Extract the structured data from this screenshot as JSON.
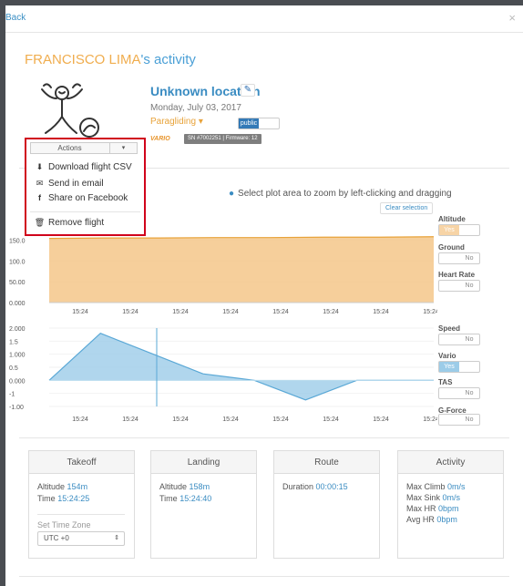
{
  "topbar": {
    "back_label": "Back",
    "close_label": "×"
  },
  "header": {
    "pilot_name": "FRANCISCO LIMA",
    "title_suffix": "'s activity"
  },
  "flight": {
    "location": "Unknown location",
    "date": "Monday, July 03, 2017",
    "sport": "Paragliding",
    "visibility": "public",
    "device_brand": "VARIO",
    "device_info": "SN #7002251 | Firmware: 12"
  },
  "actions": {
    "button_label": "Actions",
    "items": [
      {
        "label": "Download flight CSV",
        "icon": "download-icon"
      },
      {
        "label": "Send in email",
        "icon": "envelope-icon"
      },
      {
        "label": "Share on Facebook",
        "icon": "facebook-icon"
      },
      {
        "label": "Remove flight",
        "icon": "trash-icon"
      }
    ]
  },
  "chart_controls": {
    "select_info": "Select plot area to zoom by left-clicking and dragging",
    "clear_label": "Clear selection"
  },
  "toggles": {
    "altitude": {
      "label": "Altitude",
      "value": "Yes"
    },
    "ground": {
      "label": "Ground",
      "value": "No"
    },
    "heart_rate": {
      "label": "Heart Rate",
      "value": "No"
    },
    "speed": {
      "label": "Speed",
      "value": "No"
    },
    "vario": {
      "label": "Vario",
      "value": "Yes"
    },
    "tas": {
      "label": "TAS",
      "value": "No"
    },
    "gforce": {
      "label": "G-Force",
      "value": "No"
    }
  },
  "chart_data": [
    {
      "type": "area",
      "x_tick_labels": [
        "15:24",
        "15:24",
        "15:24",
        "15:24",
        "15:24",
        "15:24",
        "15:24",
        "15:24"
      ],
      "y_tick_labels": [
        "150.0",
        "100.0",
        "50.00",
        "0.000"
      ],
      "ylim": [
        0,
        175
      ],
      "series": [
        {
          "name": "Altitude",
          "color": "#f5c78a",
          "values": [
            154,
            155,
            155,
            156,
            156,
            157,
            157,
            158
          ]
        }
      ]
    },
    {
      "type": "area",
      "x_tick_labels": [
        "15:24",
        "15:24",
        "15:24",
        "15:24",
        "15:24",
        "15:24",
        "15:24",
        "15:24"
      ],
      "y_tick_labels": [
        "2.000",
        "1.5",
        "1.000",
        "0.5",
        "0.000",
        "-1",
        "-1.00"
      ],
      "ylim": [
        -1,
        2
      ],
      "series": [
        {
          "name": "Vario",
          "color": "#9ccce8",
          "x_seconds": [
            0,
            2,
            6,
            8,
            10,
            12,
            15
          ],
          "values": [
            0,
            1.8,
            0.25,
            0.0,
            -0.75,
            0.0,
            0.0
          ]
        }
      ]
    }
  ],
  "cards": {
    "takeoff": {
      "title": "Takeoff",
      "altitude_label": "Altitude",
      "altitude": "154m",
      "time_label": "Time",
      "time": "15:24:25",
      "tz_label": "Set Time Zone",
      "tz_value": "UTC +0"
    },
    "landing": {
      "title": "Landing",
      "altitude_label": "Altitude",
      "altitude": "158m",
      "time_label": "Time",
      "time": "15:24:40"
    },
    "route": {
      "title": "Route",
      "duration_label": "Duration",
      "duration": "00:00:15"
    },
    "activity": {
      "title": "Activity",
      "max_climb_label": "Max Climb",
      "max_climb": "0m/s",
      "max_sink_label": "Max Sink",
      "max_sink": "0m/s",
      "max_hr_label": "Max HR",
      "max_hr": "0bpm",
      "avg_hr_label": "Avg HR",
      "avg_hr": "0bpm"
    }
  },
  "colors": {
    "accent": "#3a8cc2",
    "pilot": "#f0ad4e",
    "highlight": "#d0021b"
  }
}
